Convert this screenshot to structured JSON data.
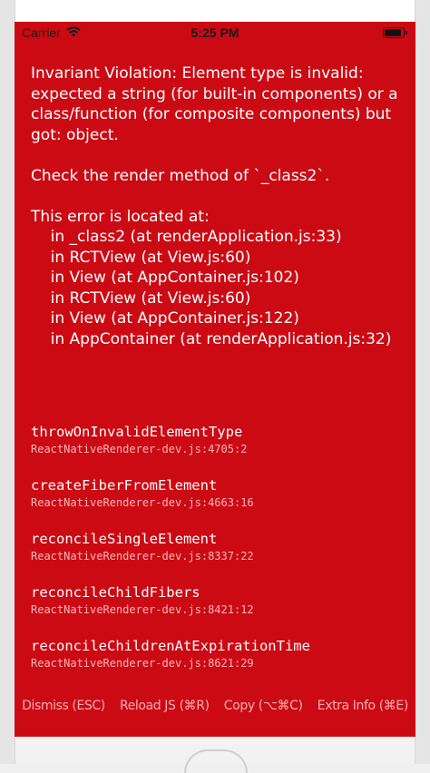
{
  "status_bar": {
    "carrier": "Carrier",
    "time": "5:25 PM",
    "wifi_icon": "wifi-icon",
    "battery_icon": "battery-icon",
    "battery_level": 0.9
  },
  "error": {
    "message": "Invariant Violation: Element type is invalid: expected a string (for built-in components) or a class/function (for composite components) but got: object.\n\nCheck the render method of `_class2`.\n\nThis error is located at:\n    in _class2 (at renderApplication.js:33)\n    in RCTView (at View.js:60)\n    in View (at AppContainer.js:102)\n    in RCTView (at View.js:60)\n    in View (at AppContainer.js:122)\n    in AppContainer (at renderApplication.js:32)"
  },
  "stack": [
    {
      "fn": "throwOnInvalidElementType",
      "loc": "ReactNativeRenderer-dev.js:4705:2"
    },
    {
      "fn": "createFiberFromElement",
      "loc": "ReactNativeRenderer-dev.js:4663:16"
    },
    {
      "fn": "reconcileSingleElement",
      "loc": "ReactNativeRenderer-dev.js:8337:22"
    },
    {
      "fn": "reconcileChildFibers",
      "loc": "ReactNativeRenderer-dev.js:8421:12"
    },
    {
      "fn": "reconcileChildrenAtExpirationTime",
      "loc": "ReactNativeRenderer-dev.js:8621:29"
    }
  ],
  "actions": {
    "dismiss": "Dismiss (ESC)",
    "reload": "Reload JS (⌘R)",
    "copy": "Copy (⌥⌘C)",
    "extra": "Extra Info (⌘E)"
  },
  "colors": {
    "background": "#cc0a14",
    "text": "#ffffff"
  }
}
